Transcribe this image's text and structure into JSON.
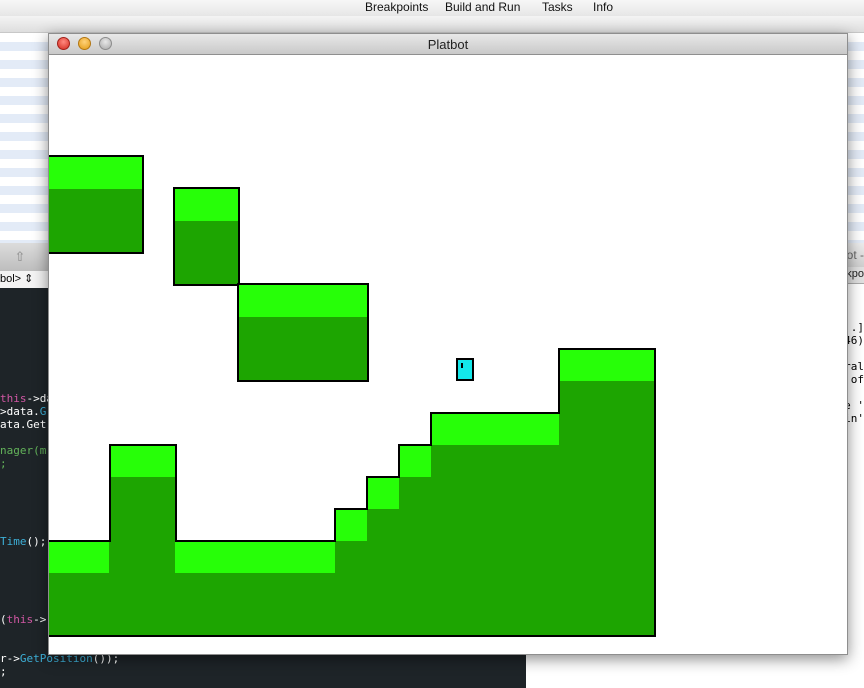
{
  "menubar": {
    "items": [
      "Breakpoints",
      "Build and Run",
      "Tasks",
      "Info"
    ]
  },
  "window": {
    "title": "Platbot"
  },
  "background_editor": {
    "symbol_popup": "bol>",
    "right_title": "ot -",
    "right_tab": "kpo",
    "console_lines": [
      ".]",
      "46)",
      "ral",
      "of",
      "e '",
      "in'"
    ]
  },
  "code_lines": [
    {
      "parts": [
        [
          "kw",
          "this"
        ],
        [
          "op",
          "->da"
        ]
      ]
    },
    {
      "parts": [
        [
          "op",
          ">data."
        ],
        [
          "fn",
          "G"
        ]
      ]
    },
    {
      "parts": [
        [
          "op",
          "ata.Get"
        ]
      ]
    },
    {
      "parts": [
        [
          "cm",
          "nager(m"
        ]
      ]
    },
    {
      "parts": [
        [
          "cm",
          ";"
        ]
      ]
    },
    {
      "parts": [
        [
          "fn",
          "Time"
        ],
        [
          "op",
          "();"
        ]
      ]
    },
    {
      "parts": [
        [
          "op",
          "("
        ],
        [
          "kw",
          "this"
        ],
        [
          "op",
          "->"
        ]
      ]
    },
    {
      "parts": [
        [
          "op",
          "r->"
        ],
        [
          "fn",
          "GetPosition"
        ],
        [
          "op",
          "());"
        ]
      ]
    },
    {
      "parts": [
        [
          "op",
          ";"
        ]
      ]
    }
  ],
  "game": {
    "colors": {
      "grass": "#27ff08",
      "dirt": "#1da501",
      "robot": "#13e8ea",
      "outline": "#000000",
      "background": "#ffffff"
    },
    "robot": {
      "color": "cyan"
    }
  }
}
